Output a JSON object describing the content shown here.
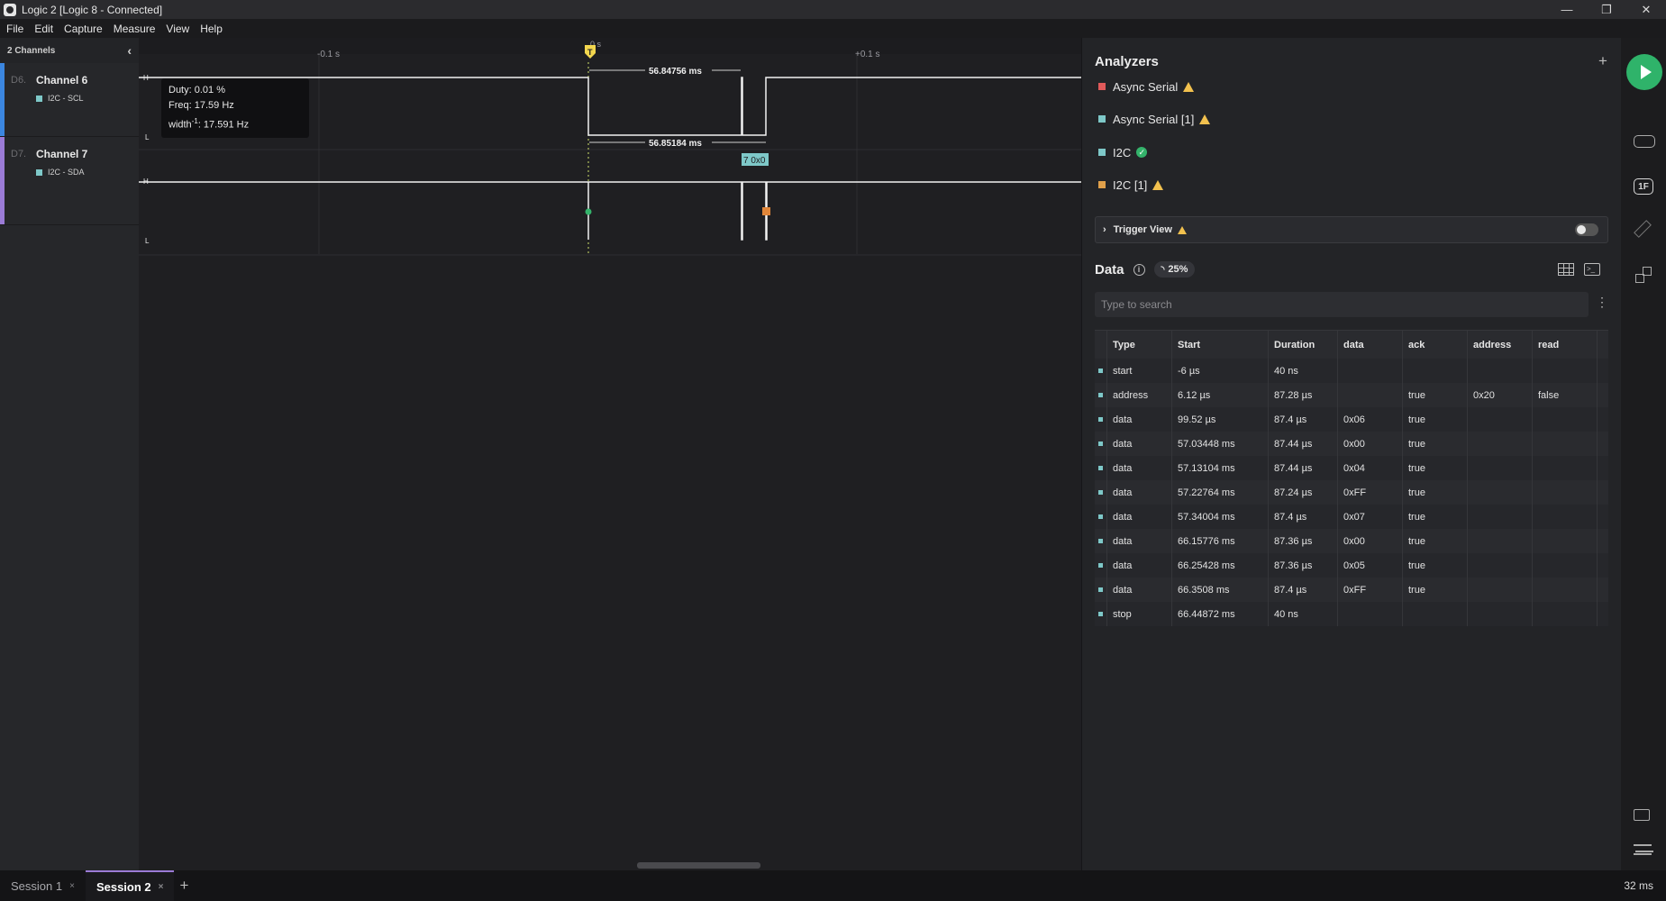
{
  "window": {
    "title": "Logic 2 [Logic 8 - Connected]",
    "controls": [
      "—",
      "❐",
      "✕"
    ]
  },
  "menu": [
    "File",
    "Edit",
    "Capture",
    "Measure",
    "View",
    "Help"
  ],
  "channels_header": "2 Channels",
  "channels": [
    {
      "id": "D6.",
      "name": "Channel 6",
      "analyzer_label": "I2C - SCL",
      "color": "#3b86e0"
    },
    {
      "id": "D7.",
      "name": "Channel 7",
      "analyzer_label": "I2C - SDA",
      "color": "#9b7bd6"
    }
  ],
  "timeline": {
    "ticks": [
      "-0.1 s",
      "0 s",
      "+0.1 s"
    ],
    "trigger_marker": "T",
    "level_high": "H",
    "level_low": "L",
    "measure_top": "56.84756 ms",
    "measure_bottom": "56.85184 ms",
    "decode_bubble": "7 0x0"
  },
  "tooltip": {
    "duty": "Duty: 0.01 %",
    "freq": "Freq: 17.59 Hz",
    "width_prefix": "width",
    "width_sup": "-1",
    "width_value": ": 17.591 Hz"
  },
  "analyzers": {
    "title": "Analyzers",
    "add": "+",
    "items": [
      {
        "name": "Async Serial",
        "status": "warning",
        "color": "#e05a5a"
      },
      {
        "name": "Async Serial [1]",
        "status": "warning",
        "color": "#7ec8c8"
      },
      {
        "name": "I2C",
        "status": "ok",
        "color": "#7ec8c8"
      },
      {
        "name": "I2C [1]",
        "status": "warning",
        "color": "#e0a04a"
      }
    ],
    "trigger_view": "Trigger View"
  },
  "data_panel": {
    "title": "Data",
    "progress": "25%",
    "search_placeholder": "Type to search",
    "columns": [
      "Type",
      "Start",
      "Duration",
      "data",
      "ack",
      "address",
      "read"
    ],
    "rows": [
      [
        "start",
        "-6 µs",
        "40 ns",
        "",
        "",
        "",
        ""
      ],
      [
        "address",
        "6.12 µs",
        "87.28 µs",
        "",
        "true",
        "0x20",
        "false"
      ],
      [
        "data",
        "99.52 µs",
        "87.4 µs",
        "0x06",
        "true",
        "",
        ""
      ],
      [
        "data",
        "57.03448 ms",
        "87.44 µs",
        "0x00",
        "true",
        "",
        ""
      ],
      [
        "data",
        "57.13104 ms",
        "87.44 µs",
        "0x04",
        "true",
        "",
        ""
      ],
      [
        "data",
        "57.22764 ms",
        "87.24 µs",
        "0xFF",
        "true",
        "",
        ""
      ],
      [
        "data",
        "57.34004 ms",
        "87.4 µs",
        "0x07",
        "true",
        "",
        ""
      ],
      [
        "data",
        "66.15776 ms",
        "87.36 µs",
        "0x00",
        "true",
        "",
        ""
      ],
      [
        "data",
        "66.25428 ms",
        "87.36 µs",
        "0x05",
        "true",
        "",
        ""
      ],
      [
        "data",
        "66.3508 ms",
        "87.4 µs",
        "0xFF",
        "true",
        "",
        ""
      ],
      [
        "stop",
        "66.44872 ms",
        "40 ns",
        "",
        "",
        "",
        ""
      ]
    ]
  },
  "sidebar": {
    "icons": [
      "play-icon",
      "device-settings-icon",
      "1f-icon",
      "ruler-icon",
      "extensions-icon",
      "chat-icon",
      "menu-icon"
    ],
    "accent": "#2fb36a"
  },
  "tabs": [
    {
      "label": "Session 1",
      "active": false
    },
    {
      "label": "Session 2",
      "active": true
    }
  ],
  "tab_close": "×",
  "tab_add": "+",
  "zoom": "32 ms"
}
